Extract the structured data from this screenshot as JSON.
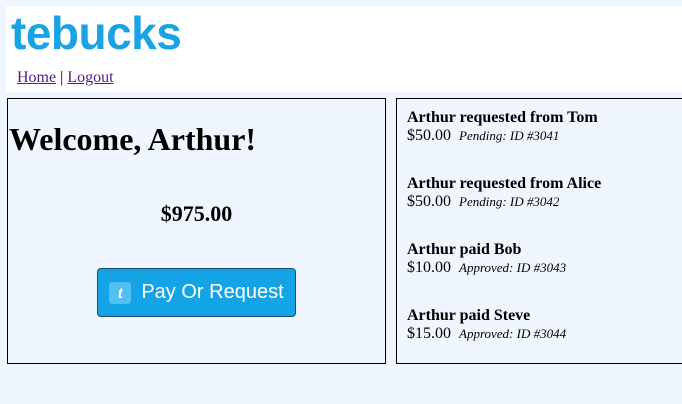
{
  "app": {
    "logo": "tebucks"
  },
  "nav": {
    "home": "Home",
    "separator": "|",
    "logout": "Logout"
  },
  "account": {
    "welcome": "Welcome, Arthur!",
    "balance": "$975.00",
    "pay_button_label": "Pay Or Request",
    "pay_button_icon_letter": "t"
  },
  "transfers": [
    {
      "title": "Arthur requested from Tom",
      "amount": "$50.00",
      "status": "Pending: ID #3041"
    },
    {
      "title": "Arthur requested from Alice",
      "amount": "$50.00",
      "status": "Pending: ID #3042"
    },
    {
      "title": "Arthur paid Bob",
      "amount": "$10.00",
      "status": "Approved: ID #3043"
    },
    {
      "title": "Arthur paid Steve",
      "amount": "$15.00",
      "status": "Approved: ID #3044"
    }
  ],
  "colors": {
    "brand": "#1aa3e4",
    "button": "#14a4e6",
    "background": "#eff6ff",
    "link": "#551a8b"
  }
}
